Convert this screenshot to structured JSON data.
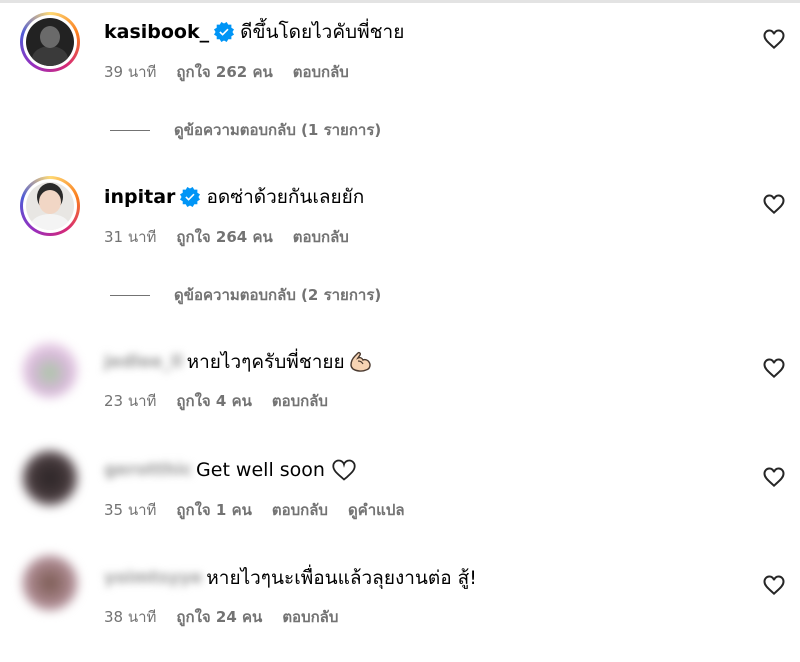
{
  "comments": [
    {
      "username": "kasibook_",
      "verified": true,
      "text": "ดีขึ้นโดยไวคับพี่ชาย",
      "time": "39 นาที",
      "likes": "ถูกใจ 262 คน",
      "reply": "ตอบกลับ",
      "view_replies": "ดูข้อความตอบกลับ (1 รายการ)"
    },
    {
      "username": "inpitar",
      "verified": true,
      "text": "อดซ่าด้วยกันเลยยัก",
      "time": "31 นาที",
      "likes": "ถูกใจ 264 คน",
      "reply": "ตอบกลับ",
      "view_replies": "ดูข้อความตอบกลับ (2 รายการ)"
    },
    {
      "username": "jedlee_ll",
      "blurred": true,
      "text": "หายไวๆครับพี่ชายย",
      "emoji": "flexed-biceps-emoji",
      "time": "23 นาที",
      "likes": "ถูกใจ 4 คน",
      "reply": "ตอบกลับ"
    },
    {
      "username": "gerotthic",
      "blurred": true,
      "text": "Get well soon",
      "emoji": "white-heart-emoji",
      "time": "35 นาที",
      "likes": "ถูกใจ 1 คน",
      "reply": "ตอบกลับ",
      "translate": "ดูคำแปล"
    },
    {
      "username": "yoimtsyye",
      "blurred": true,
      "text": "หายไวๆนะเพื่อนแล้วลุยงานต่อ สู้!",
      "time": "38 นาที",
      "likes": "ถูกใจ 24 คน",
      "reply": "ตอบกลับ"
    }
  ],
  "icons": {
    "like": "heart-outline-icon",
    "verified": "verified-badge-icon"
  },
  "colors": {
    "verified_blue": "#0095f6",
    "meta_gray": "#737373",
    "text": "#000000"
  }
}
